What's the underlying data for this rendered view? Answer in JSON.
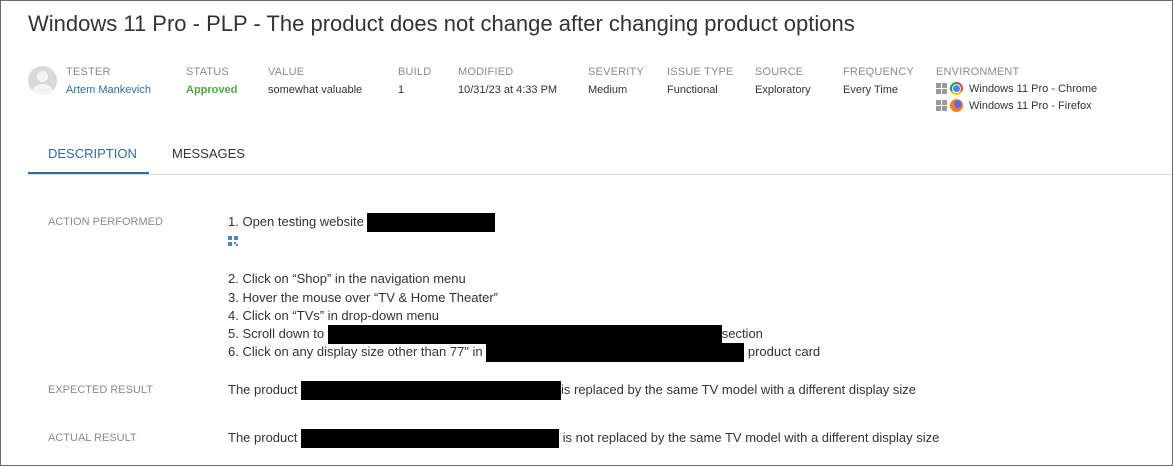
{
  "issue": {
    "title": "Windows 11 Pro - PLP - The product does not change after changing product options"
  },
  "meta": {
    "tester": {
      "label": "TESTER",
      "value": "Artem Mankevich"
    },
    "status": {
      "label": "STATUS",
      "value": "Approved"
    },
    "value": {
      "label": "VALUE",
      "value": "somewhat valuable"
    },
    "build": {
      "label": "BUILD",
      "value": "1"
    },
    "modified": {
      "label": "MODIFIED",
      "value": "10/31/23 at 4:33 PM"
    },
    "severity": {
      "label": "SEVERITY",
      "value": "Medium"
    },
    "issue_type": {
      "label": "ISSUE TYPE",
      "value": "Functional"
    },
    "source": {
      "label": "SOURCE",
      "value": "Exploratory"
    },
    "frequency": {
      "label": "FREQUENCY",
      "value": "Every Time"
    },
    "environment": {
      "label": "ENVIRONMENT",
      "items": [
        {
          "label": "Windows 11 Pro - Chrome",
          "os_icon": "windows-icon",
          "browser_icon": "chrome-icon"
        },
        {
          "label": "Windows 11 Pro - Firefox",
          "os_icon": "windows-icon",
          "browser_icon": "firefox-icon"
        }
      ]
    }
  },
  "tabs": [
    {
      "label": "DESCRIPTION",
      "active": true
    },
    {
      "label": "MESSAGES",
      "active": false
    }
  ],
  "description": {
    "action_performed": {
      "label": "ACTION PERFORMED",
      "steps": [
        {
          "text": "1. Open testing website ",
          "after": ""
        },
        {
          "text": "2. Click on “Shop” in the navigation menu"
        },
        {
          "text": "3. Hover the mouse over “TV & Home Theater”"
        },
        {
          "text": "4. Click on “TVs” in drop-down menu"
        },
        {
          "text": "5. Scroll down to ",
          "after": "section"
        },
        {
          "text": "6. Click on any display size other than 77\" in ",
          "after": " product card"
        }
      ]
    },
    "expected_result": {
      "label": "EXPECTED RESULT",
      "before": "The product ",
      "after": "is replaced by the same TV model with a different display size"
    },
    "actual_result": {
      "label": "ACTUAL RESULT",
      "before": "The product ",
      "after": " is not replaced by the same TV model with a different display size"
    }
  },
  "colors": {
    "accent": "#2e6da4",
    "approved": "#4caa3c",
    "label_gray": "#8a8a8a",
    "redaction": "#000000"
  }
}
